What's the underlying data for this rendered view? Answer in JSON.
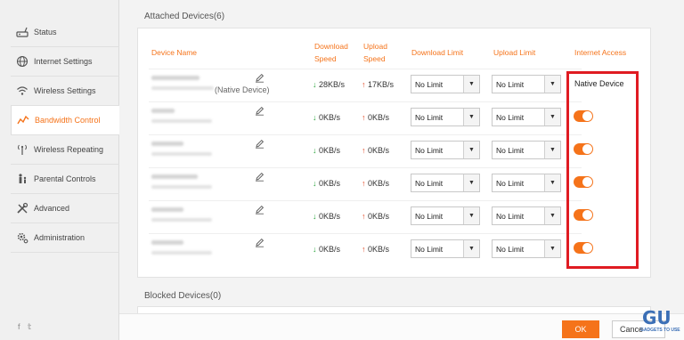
{
  "sidebar": {
    "items": [
      {
        "label": "Status",
        "icon": "router-icon"
      },
      {
        "label": "Internet Settings",
        "icon": "globe-icon"
      },
      {
        "label": "Wireless Settings",
        "icon": "wifi-icon"
      },
      {
        "label": "Bandwidth Control",
        "icon": "bandwidth-icon"
      },
      {
        "label": "Wireless Repeating",
        "icon": "antenna-icon"
      },
      {
        "label": "Parental Controls",
        "icon": "parental-icon"
      },
      {
        "label": "Advanced",
        "icon": "tools-icon"
      },
      {
        "label": "Administration",
        "icon": "gear-icon"
      }
    ],
    "active": "Bandwidth Control",
    "social": "f  𝕥"
  },
  "attached": {
    "title": "Attached Devices(6)",
    "headers": {
      "device_name": "Device Name",
      "download_speed": "Download\nSpeed",
      "upload_speed": "Upload\nSpeed",
      "download_limit": "Download Limit",
      "upload_limit": "Upload Limit",
      "internet_access": "Internet Access"
    },
    "rows": [
      {
        "tag": "(Native Device)",
        "download": "28KB/s",
        "upload": "17KB/s",
        "dl_limit": "No Limit",
        "ul_limit": "No Limit",
        "access": "Native Device"
      },
      {
        "tag": "",
        "download": "0KB/s",
        "upload": "0KB/s",
        "dl_limit": "No Limit",
        "ul_limit": "No Limit",
        "access": "on"
      },
      {
        "tag": "",
        "download": "0KB/s",
        "upload": "0KB/s",
        "dl_limit": "No Limit",
        "ul_limit": "No Limit",
        "access": "on"
      },
      {
        "tag": "",
        "download": "0KB/s",
        "upload": "0KB/s",
        "dl_limit": "No Limit",
        "ul_limit": "No Limit",
        "access": "on"
      },
      {
        "tag": "",
        "download": "0KB/s",
        "upload": "0KB/s",
        "dl_limit": "No Limit",
        "ul_limit": "No Limit",
        "access": "on"
      },
      {
        "tag": "",
        "download": "0KB/s",
        "upload": "0KB/s",
        "dl_limit": "No Limit",
        "ul_limit": "No Limit",
        "access": "on"
      }
    ]
  },
  "blocked": {
    "title": "Blocked Devices(0)"
  },
  "footer": {
    "ok": "OK",
    "cancel": "Cance"
  },
  "watermark": {
    "logo": "GU",
    "text": "GADGETS TO USE"
  },
  "colors": {
    "accent": "#f5731a",
    "highlight": "#e01b22",
    "down": "#2aa33b",
    "up": "#e34a26"
  }
}
